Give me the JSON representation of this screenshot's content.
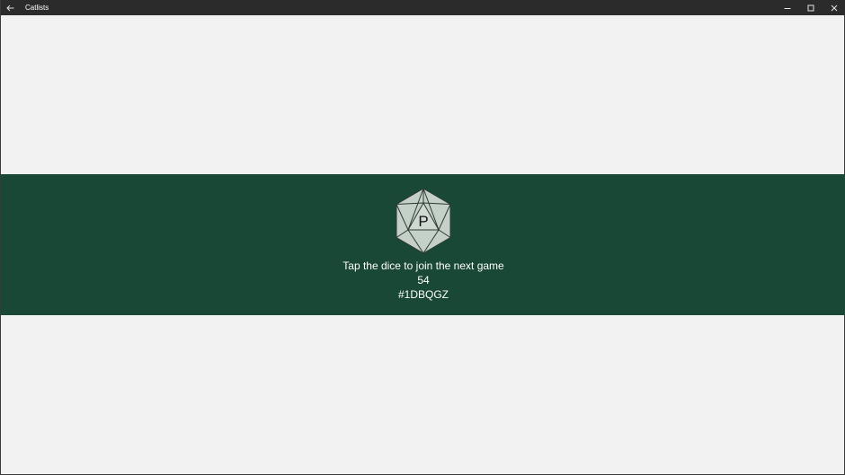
{
  "window": {
    "title": "Catlists",
    "back_icon": "arrow-left-icon",
    "controls": [
      "minimize-icon",
      "maximize-icon",
      "close-icon"
    ]
  },
  "banner": {
    "dice_letter": "P",
    "prompt": "Tap the dice to join the next game",
    "count": "54",
    "code": "#1DBQGZ",
    "background_color": "#194836",
    "dice_fill": "#c5d0c8"
  }
}
